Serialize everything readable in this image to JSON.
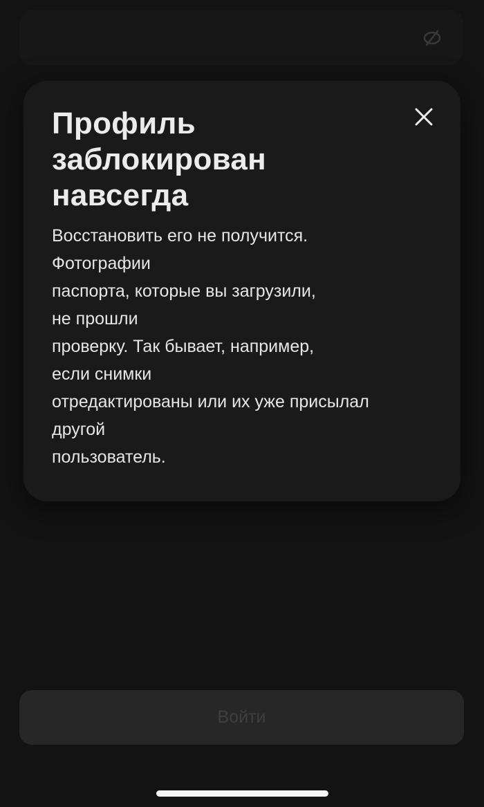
{
  "background": {
    "field_icon": "eye-off-icon"
  },
  "modal": {
    "title": "Профиль заблокирован навсегда",
    "close_icon": "close-icon",
    "body_lines": [
      "Восстановить его не получится.",
      "Фотографии",
      "паспорта, которые вы загрузили,",
      "не прошли",
      "проверку. Так бывает, например,",
      "если снимки",
      "отредактированы или их уже присылал",
      "другой",
      "пользователь."
    ]
  },
  "login_button": {
    "label": "Войти"
  },
  "colors": {
    "background": "#131313",
    "modal": "#1a1a1a",
    "button": "#272727",
    "button_text": "#3f3f3f",
    "text": "#e6e6e6"
  }
}
